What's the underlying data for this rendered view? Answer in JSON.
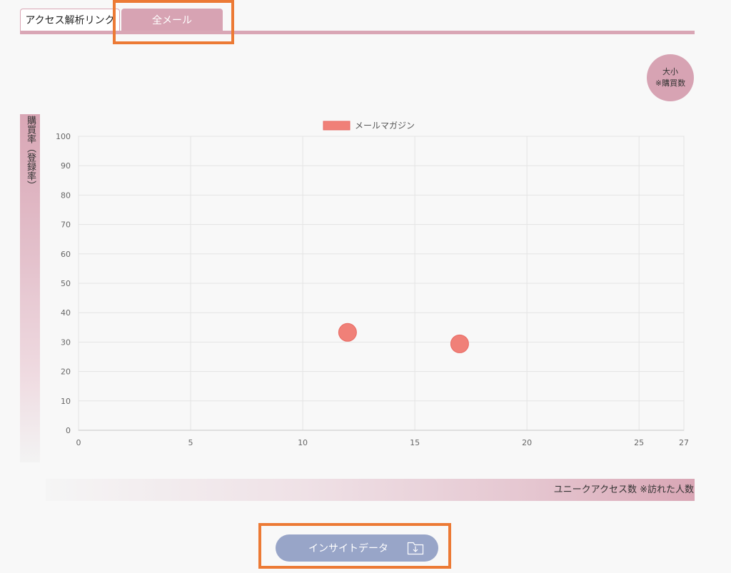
{
  "tabs": [
    {
      "label": "アクセス解析リンク",
      "active": false
    },
    {
      "label": "全メール",
      "active": true
    }
  ],
  "size_badge": {
    "line1": "大小",
    "line2": "※購買数"
  },
  "y_axis_title": "購買率（登録率）",
  "x_axis_title": "ユニークアクセス数 ※訪れた人数",
  "insight_button": {
    "label": "インサイトデータ",
    "icon": "folder-download-icon"
  },
  "colors": {
    "accent": "#d7a3b3",
    "point": "#f08078",
    "button": "#98a5c8",
    "highlight": "#ec7a35"
  },
  "chart_data": {
    "type": "scatter",
    "series": [
      {
        "name": "メールマガジン",
        "points": [
          {
            "x": 12,
            "y": 33.3
          },
          {
            "x": 17,
            "y": 29.4
          }
        ]
      }
    ],
    "xlim": [
      0,
      27
    ],
    "ylim": [
      0,
      100
    ],
    "xticks": [
      0,
      5,
      10,
      15,
      20,
      25,
      27
    ],
    "yticks": [
      0,
      10,
      20,
      30,
      40,
      50,
      60,
      70,
      80,
      90,
      100
    ],
    "grid": true,
    "legend": "top"
  }
}
